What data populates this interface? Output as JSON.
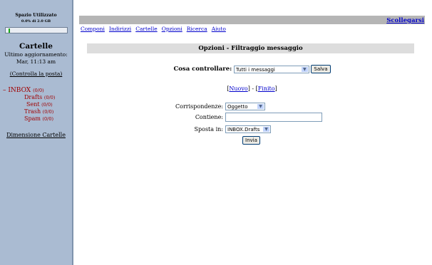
{
  "sidebar": {
    "quota_title": "Spazio Utilizzato",
    "quota_value": "0.0% di 2.0 GB",
    "quota_percent": 0.0,
    "folders_title": "Cartelle",
    "last_update_label": "Ultimo aggiornamento:",
    "last_update_time": "Mar, 11:13 am",
    "check_mail": "(Controlla la posta)",
    "folders": [
      {
        "name": "INBOX",
        "count": "(0/0)"
      },
      {
        "name": "Drafts",
        "count": "(0/0)"
      },
      {
        "name": "Sent",
        "count": "(0/0)"
      },
      {
        "name": "Trash",
        "count": "(0/0)"
      },
      {
        "name": "Spam",
        "count": "(0/0)"
      }
    ],
    "folder_size_link": "Dimensione Cartelle"
  },
  "header": {
    "logout": "Scollegarsi",
    "nav": [
      "Componi",
      "Indirizzi",
      "Cartelle",
      "Opzioni",
      "Ricerca",
      "Aiuto"
    ]
  },
  "filter": {
    "title": "Opzioni - Filtraggio messaggio",
    "check_label": "Cosa controllare:",
    "check_value": "Tutti i messaggi",
    "save_button": "Salva",
    "new_link": "Nuovo",
    "done_link": "Finito",
    "match_label": "Corrispondenze:",
    "match_value": "Oggetto",
    "contains_label": "Contiene:",
    "contains_value": "",
    "move_label": "Sposta in:",
    "move_value": "INBOX.Drafts",
    "send_button": "Invia"
  },
  "colors": {
    "sidebar_bg": "#aabbd2",
    "link": "#0000cc",
    "folder": "#a00000",
    "quota_fill": "#14a814"
  }
}
